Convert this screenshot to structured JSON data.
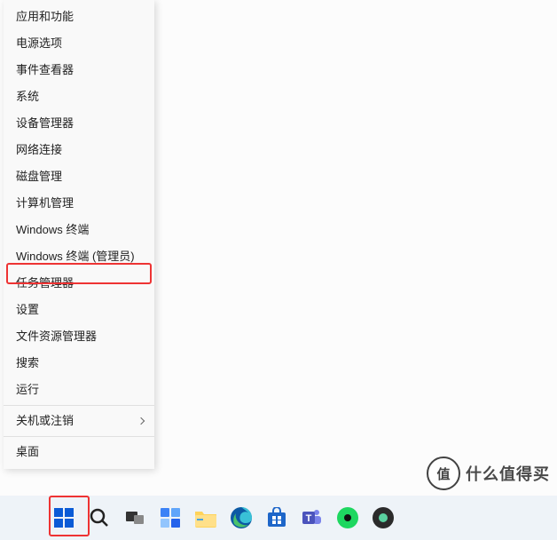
{
  "menu": {
    "items": [
      {
        "label": "应用和功能"
      },
      {
        "label": "电源选项"
      },
      {
        "label": "事件查看器"
      },
      {
        "label": "系统"
      },
      {
        "label": "设备管理器"
      },
      {
        "label": "网络连接"
      },
      {
        "label": "磁盘管理"
      },
      {
        "label": "计算机管理"
      },
      {
        "label": "Windows 终端"
      },
      {
        "label": "Windows 终端 (管理员)"
      },
      {
        "label": "任务管理器"
      },
      {
        "label": "设置"
      },
      {
        "label": "文件资源管理器"
      },
      {
        "label": "搜索"
      },
      {
        "label": "运行"
      },
      {
        "label": "关机或注销",
        "sub": true
      },
      {
        "label": "桌面"
      }
    ]
  },
  "watermark": {
    "logo": "值",
    "text": "什么值得买"
  },
  "taskbar": {
    "icons": [
      "start",
      "search",
      "task-view",
      "widgets",
      "explorer",
      "edge",
      "store",
      "teams",
      "spotify",
      "app"
    ]
  },
  "colors": {
    "highlight": "#e33",
    "taskbar": "#eef3f8",
    "menu": "#f9f9f9"
  }
}
